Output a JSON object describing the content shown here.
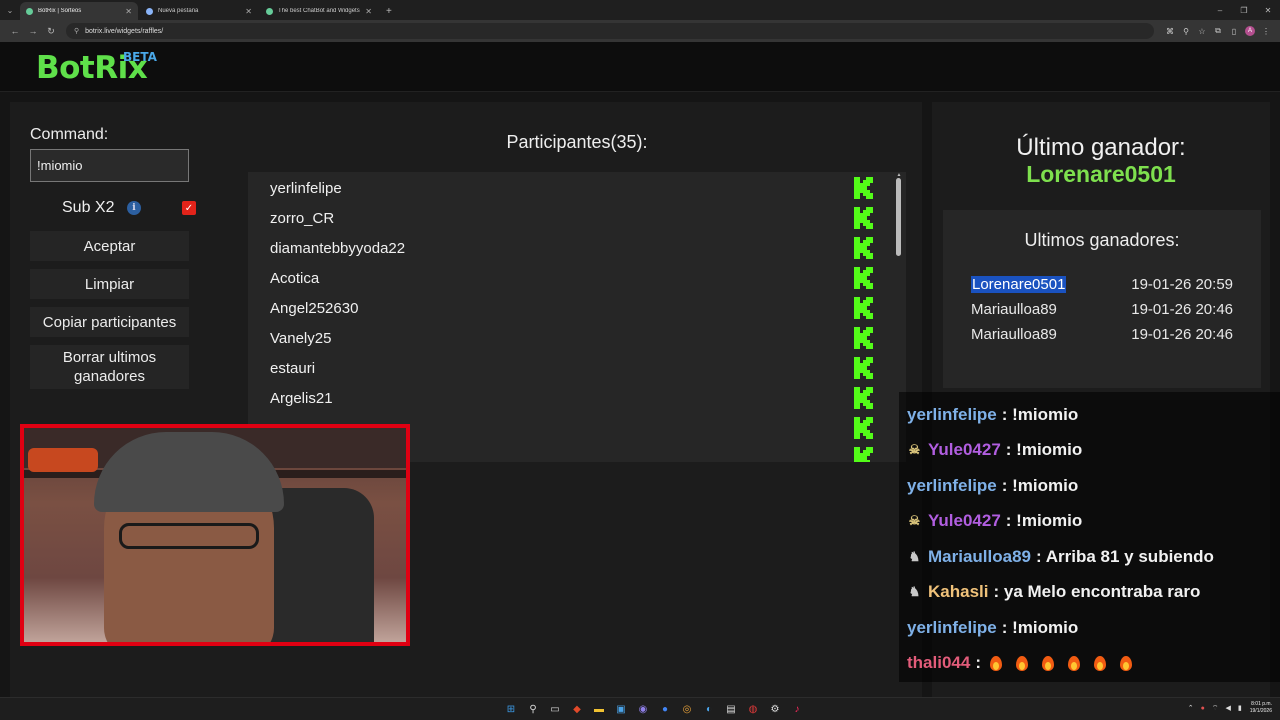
{
  "browser": {
    "tabs": [
      {
        "label": "BotRix | Sorteos",
        "active": true
      },
      {
        "label": "Nueva pestaña",
        "active": false
      },
      {
        "label": "The best ChatBot and Widgets",
        "active": false
      }
    ],
    "url": "botrix.live/widgets/raffles/"
  },
  "app": {
    "logo": "BotRix",
    "badge": "BETA"
  },
  "controls": {
    "command_label": "Command:",
    "command_value": "!miomio",
    "subx2_label": "Sub X2",
    "subx2_checked": true,
    "buttons": {
      "accept": "Aceptar",
      "clear": "Limpiar",
      "copy": "Copiar participantes",
      "delete_winners": "Borrar ultimos ganadores"
    }
  },
  "participants": {
    "title": "Participantes(35):",
    "list": [
      "yerlinfelipe",
      "zorro_CR",
      "diamantebbyyoda22",
      "Acotica",
      "Angel252630",
      "Vanely25",
      "estauri",
      "Argelis21"
    ]
  },
  "winner": {
    "title": "Último ganador:",
    "name": "Lorenare0501",
    "history_title": "Ultimos ganadores:",
    "history": [
      {
        "name": "Lorenare0501",
        "date": "19-01-26 20:59"
      },
      {
        "name": "Mariaulloa89",
        "date": "19-01-26 20:46"
      },
      {
        "name": "Mariaulloa89",
        "date": "19-01-26 20:46"
      }
    ]
  },
  "chat": [
    {
      "user": "yerlinfelipe",
      "text": ": !miomio",
      "color": "#7fb1e8",
      "badge": ""
    },
    {
      "user": "Yule0427",
      "text": ": !miomio",
      "color": "#b15ee0",
      "badge": "skull-icon"
    },
    {
      "user": "yerlinfelipe",
      "text": ": !miomio",
      "color": "#7fb1e8",
      "badge": ""
    },
    {
      "user": "Yule0427",
      "text": ": !miomio",
      "color": "#b15ee0",
      "badge": "skull-icon"
    },
    {
      "user": "Mariaulloa89",
      "text": ": Arriba 81 y subiendo",
      "color": "#7fb1e8",
      "badge": "knight-icon"
    },
    {
      "user": "Kahasli",
      "text": ": ya Melo encontraba raro",
      "color": "#f0c27a",
      "badge": "knight-icon"
    },
    {
      "user": "yerlinfelipe",
      "text": ": !miomio",
      "color": "#7fb1e8",
      "badge": ""
    },
    {
      "user": "thali044",
      "text": ":",
      "color": "#e25c7a",
      "badge": "",
      "emotes": 6
    }
  ],
  "taskbar": {
    "clock_time": "8:01 p.m.",
    "clock_date": "19/1/2026"
  },
  "colors": {
    "brand_green": "#5fe04a",
    "winner_green": "#7ee04e",
    "cam_border": "#e00012",
    "kick_green": "#53fc18",
    "selection_blue": "#1a52c0"
  }
}
